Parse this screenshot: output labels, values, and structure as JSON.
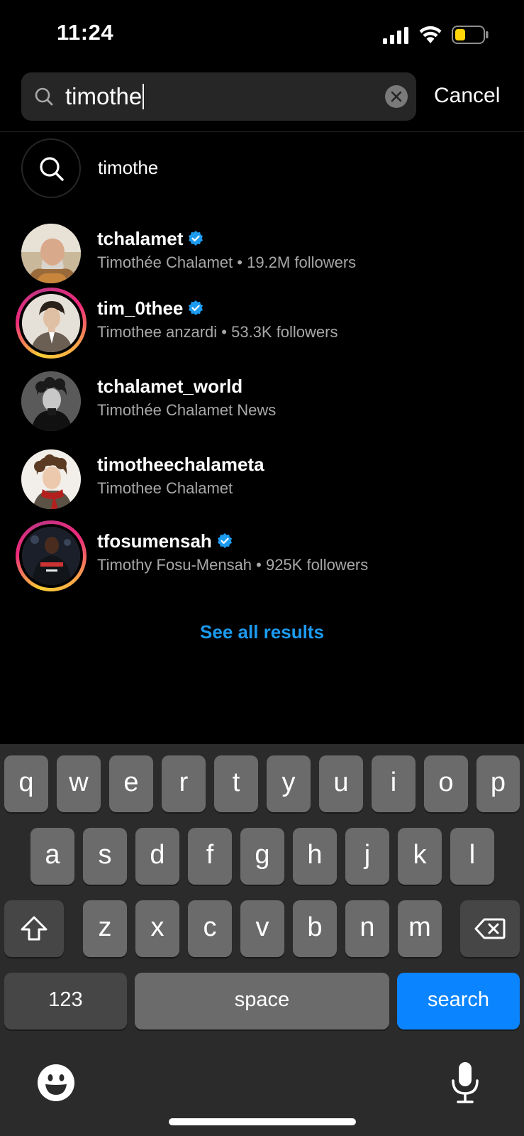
{
  "status_bar": {
    "time": "11:24"
  },
  "search": {
    "value": "timothe",
    "cancel_label": "Cancel"
  },
  "query_suggestion": {
    "text": "timothe"
  },
  "results": [
    {
      "username": "tchalamet",
      "verified": true,
      "subtitle": "Timothée Chalamet • 19.2M followers",
      "story_ring": false
    },
    {
      "username": "tim_0thee",
      "verified": true,
      "subtitle": "Timothee anzardi • 53.3K followers",
      "story_ring": true
    },
    {
      "username": "tchalamet_world",
      "verified": false,
      "subtitle": "Timothée Chalamet News",
      "story_ring": false
    },
    {
      "username": "timotheechalameta",
      "verified": false,
      "subtitle": "Timothee Chalamet",
      "story_ring": false
    },
    {
      "username": "tfosumensah",
      "verified": true,
      "subtitle": "Timothy Fosu-Mensah • 925K followers",
      "story_ring": true
    }
  ],
  "see_all_label": "See all results",
  "keyboard": {
    "row1": [
      "q",
      "w",
      "e",
      "r",
      "t",
      "y",
      "u",
      "i",
      "o",
      "p"
    ],
    "row2": [
      "a",
      "s",
      "d",
      "f",
      "g",
      "h",
      "j",
      "k",
      "l"
    ],
    "row3": [
      "z",
      "x",
      "c",
      "v",
      "b",
      "n",
      "m"
    ],
    "numbers_label": "123",
    "space_label": "space",
    "search_label": "search"
  },
  "colors": {
    "accent": "#1c9bf0",
    "verified": "#1c9bf0",
    "search_key": "#0a84ff",
    "battery": "#ffd60a"
  }
}
